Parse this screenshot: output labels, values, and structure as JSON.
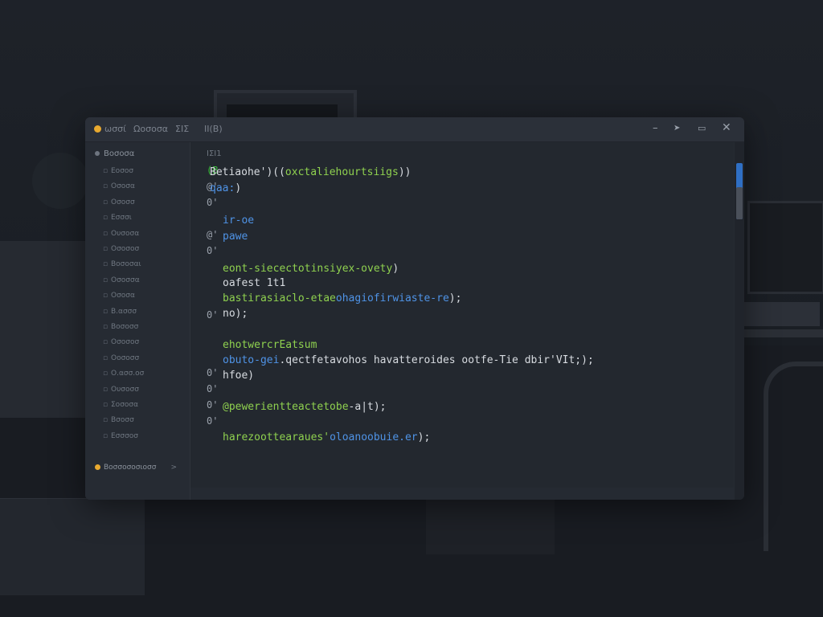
{
  "window": {
    "menu": [
      "ωσσί",
      "Ωοσοσα",
      "ΣΙΣ",
      "ΙΙ(Β)"
    ],
    "controls": [
      "–",
      "➤",
      "▭",
      "✕"
    ]
  },
  "sidebar": {
    "header": "Βοσοσα",
    "items": [
      "Εοσοσ",
      "Οσοσα",
      "Οσοσσ",
      "Εσσσι",
      "Ουσοσα",
      "Οσοσοσ",
      "Βοσοσαι",
      "Οσοσσα",
      "Οσοσα",
      "Β.ασσσ",
      "Βοσοσσ",
      "Οσοσοσ",
      "Οοσοσσ",
      "Ο.ασσ.οσ",
      "Ουσοσσ",
      "Σοσοσα",
      "Βσοσσ",
      "Εσσσοσ"
    ],
    "footer": "Βοσσοσοσιοσσ",
    "footer_chevron": ">"
  },
  "editor": {
    "header": "ΙΣΙ1",
    "gutter": [
      "(Β",
      "@'",
      "0'",
      "@'",
      "0'",
      "0'",
      "0'",
      "0'",
      "0'",
      "0'"
    ],
    "lines": [
      {
        "parts": [
          {
            "t": "Betiaohe')((",
            "c": "white"
          },
          {
            "t": "oxctaliehourtsiigs",
            "c": "green"
          },
          {
            "t": "))",
            "c": "white"
          }
        ]
      },
      {
        "parts": [
          {
            "t": "qaa:",
            "c": "blue"
          },
          {
            "t": ")",
            "c": "white"
          }
        ]
      },
      {
        "parts": [
          {
            "t": "ir-oe",
            "c": "blue"
          }
        ]
      },
      {
        "parts": [
          {
            "t": "pawe",
            "c": "blue"
          }
        ]
      },
      {
        "parts": [
          {
            "t": "eont-siecectotinsiyex-ovety",
            "c": "green"
          },
          {
            "t": ")",
            "c": "white"
          }
        ]
      },
      {
        "parts": [
          {
            "t": "oafest 1t1",
            "c": "white"
          }
        ]
      },
      {
        "parts": [
          {
            "t": "bastirasiaclo-etae",
            "c": "green"
          },
          {
            "t": "ohagiofirwiaste-re",
            "c": "blue"
          },
          {
            "t": ");",
            "c": "white"
          }
        ]
      },
      {
        "parts": [
          {
            "t": "no);",
            "c": "white"
          }
        ]
      },
      {
        "parts": [
          {
            "t": "ehotwercrEatsum",
            "c": "green"
          }
        ]
      },
      {
        "parts": [
          {
            "t": "obuto-gei",
            "c": "blue"
          },
          {
            "t": ".qectfetavohos havatter",
            "c": "white"
          },
          {
            "t": "oides ootfe-Tie dbir'VIt;);",
            "c": "white"
          }
        ]
      },
      {
        "parts": [
          {
            "t": "hfoe)",
            "c": "white"
          }
        ]
      },
      {
        "parts": [
          {
            "t": "@pewerientteactetobe",
            "c": "green"
          },
          {
            "t": "-a|t);",
            "c": "white"
          }
        ]
      },
      {
        "parts": [
          {
            "t": "harezoottearaues'",
            "c": "green"
          },
          {
            "t": "oloanoobuie.er",
            "c": "blue"
          },
          {
            "t": ");",
            "c": "white"
          }
        ]
      }
    ]
  }
}
